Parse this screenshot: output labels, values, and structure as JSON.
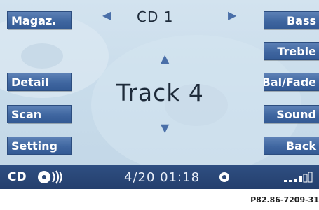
{
  "header": {
    "source_title": "CD 1",
    "prev_icon": "left-triangle-icon",
    "next_icon": "right-triangle-icon"
  },
  "left_keys": [
    {
      "label": "Magaz."
    },
    {
      "label": "Detail"
    },
    {
      "label": "Scan"
    },
    {
      "label": "Setting"
    }
  ],
  "right_keys": [
    {
      "label": "Bass"
    },
    {
      "label": "Treble"
    },
    {
      "label": "Bal/Fade"
    },
    {
      "label": "Sound"
    },
    {
      "label": "Back"
    }
  ],
  "main": {
    "track_label": "Track 4",
    "up_icon": "up-triangle-icon",
    "down_icon": "down-triangle-icon"
  },
  "status": {
    "source": "CD",
    "position": "4/20 01:18",
    "disc_icon": "cd-disc-icon",
    "record_icon": "record-dot-icon",
    "signal_icon": "signal-bars-icon"
  },
  "caption": "P82.86-7209-31",
  "colors": {
    "screen_bg": "#c7dbea",
    "softkey_bg": "#3f66a0",
    "status_bg": "#2a4676",
    "text_dark": "#1e2b3a"
  }
}
